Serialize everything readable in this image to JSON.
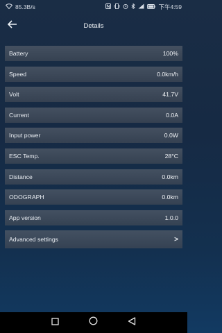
{
  "status_bar": {
    "net_speed": "85.3B/s",
    "time": "下午4:59"
  },
  "header": {
    "title": "Details"
  },
  "details": [
    {
      "label": "Battery",
      "value": "100%"
    },
    {
      "label": "Speed",
      "value": "0.0km/h"
    },
    {
      "label": "Volt",
      "value": "41.7V"
    },
    {
      "label": "Current",
      "value": "0.0A"
    },
    {
      "label": "Input power",
      "value": "0.0W"
    },
    {
      "label": "ESC Temp.",
      "value": "28°C"
    },
    {
      "label": "Distance",
      "value": "0.0km"
    },
    {
      "label": "ODOGRAPH",
      "value": "0.0km"
    },
    {
      "label": "App version",
      "value": "1.0.0"
    }
  ],
  "advanced": {
    "label": "Advanced settings",
    "chevron": ">"
  },
  "icons": {
    "back": "arrow-left-icon",
    "nav_recent": "square-icon",
    "nav_home": "circle-icon",
    "nav_back": "triangle-back-icon"
  }
}
